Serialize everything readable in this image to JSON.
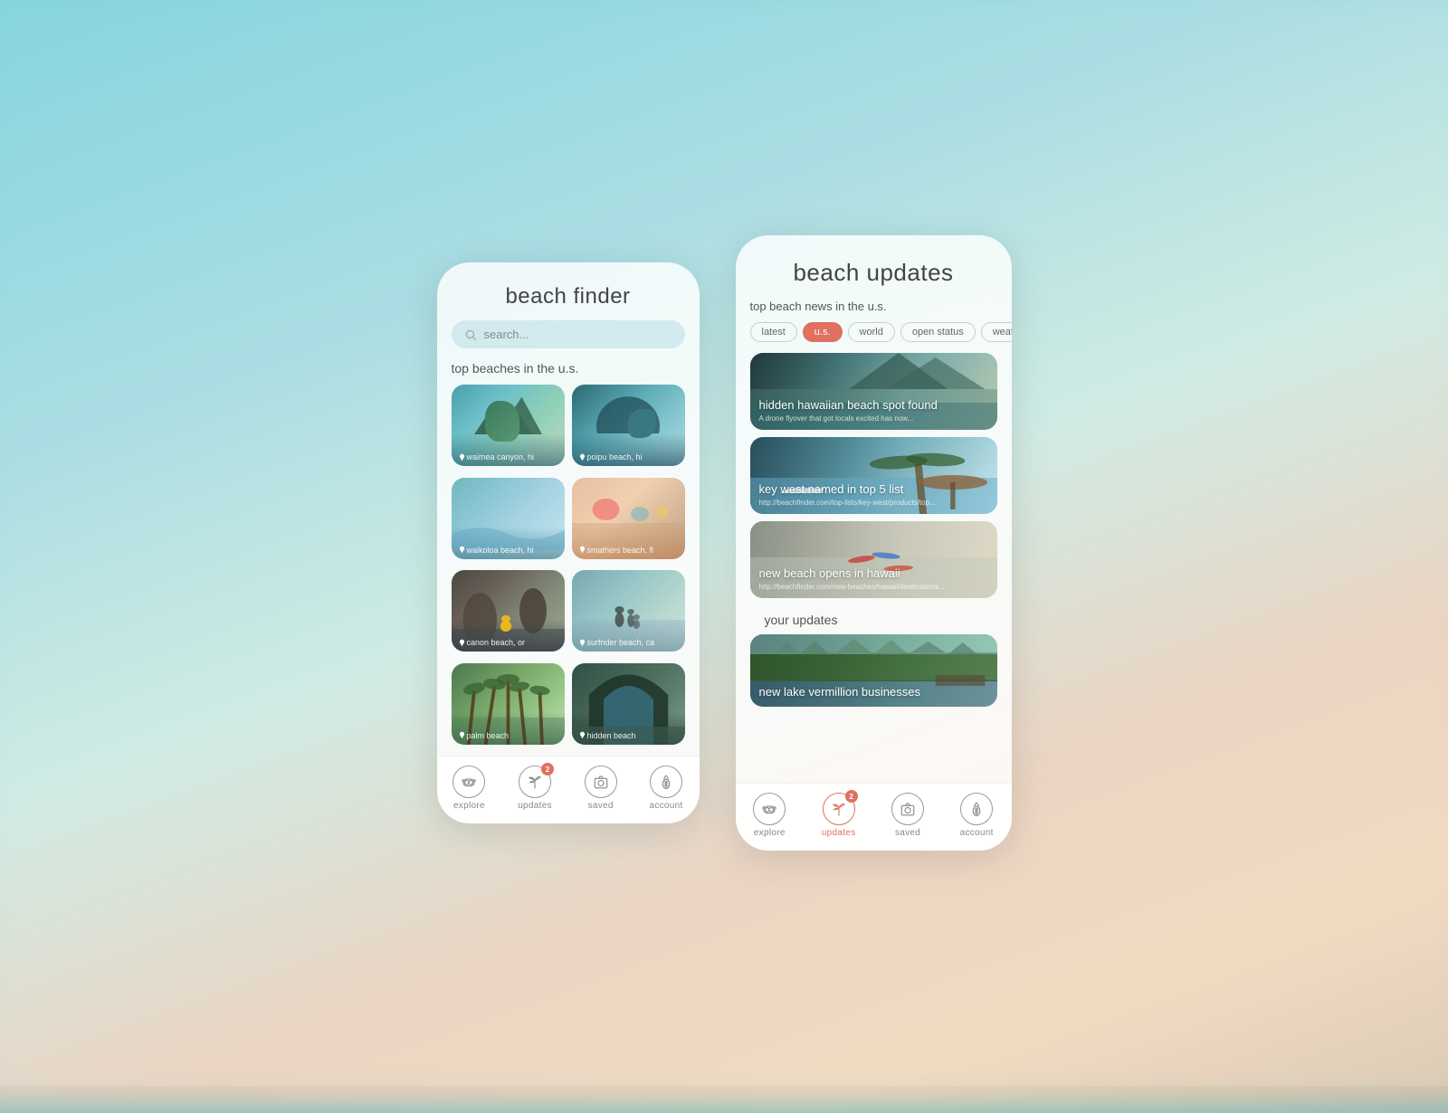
{
  "background": {
    "colors": [
      "#6ecdd8",
      "#9dd8de",
      "#c8e8e0",
      "#e8cdb8",
      "#f0d5b8"
    ]
  },
  "left_phone": {
    "title": "beach finder",
    "search_placeholder": "search...",
    "section_top_beaches": "top beaches in the u.s.",
    "beaches": [
      {
        "label": "waimea canyon, hi",
        "thumb_class": "thumb-1"
      },
      {
        "label": "poipu beach, hi",
        "thumb_class": "thumb-2"
      },
      {
        "label": "waikoloa beach, hi",
        "thumb_class": "thumb-3"
      },
      {
        "label": "smathers beach, fl",
        "thumb_class": "thumb-4"
      },
      {
        "label": "canon beach, or",
        "thumb_class": "thumb-5"
      },
      {
        "label": "surfrider beach, ca",
        "thumb_class": "thumb-6"
      },
      {
        "label": "palm beach",
        "thumb_class": "thumb-7"
      },
      {
        "label": "hidden beach",
        "thumb_class": "thumb-8"
      }
    ],
    "nav": [
      {
        "id": "explore",
        "label": "explore",
        "icon": "dive-mask",
        "active": false,
        "badge": null
      },
      {
        "id": "updates",
        "label": "updates",
        "icon": "palm-tree",
        "active": false,
        "badge": "2"
      },
      {
        "id": "saved",
        "label": "saved",
        "icon": "camera",
        "active": false,
        "badge": null
      },
      {
        "id": "account",
        "label": "account",
        "icon": "pineapple",
        "active": false,
        "badge": null
      }
    ]
  },
  "right_phone": {
    "title": "beach updates",
    "section_top_news": "top beach news in the u.s.",
    "filter_chips": [
      {
        "label": "latest",
        "active": false
      },
      {
        "label": "u.s.",
        "active": true
      },
      {
        "label": "world",
        "active": false
      },
      {
        "label": "open status",
        "active": false
      },
      {
        "label": "weather",
        "active": false
      }
    ],
    "news_articles": [
      {
        "headline": "hidden hawaiian beach spot found",
        "sub": "A drone flyover that got locals excited has now...",
        "bg_class": "news-bg-1"
      },
      {
        "headline": "key west named in top 5 list",
        "sub": "http://beachfinder.com/top-lists/key-west/products/top...",
        "bg_class": "news-bg-2"
      },
      {
        "headline": "new beach opens in hawaii",
        "sub": "http://beachfinder.com/new-beaches/hawaii/destinations...",
        "bg_class": "news-bg-3"
      }
    ],
    "section_your_updates": "your updates",
    "your_updates": [
      {
        "headline": "new lake vermillion businesses",
        "bg_class": "news-bg-4"
      }
    ],
    "nav": [
      {
        "id": "explore",
        "label": "explore",
        "icon": "dive-mask",
        "active": false,
        "badge": null
      },
      {
        "id": "updates",
        "label": "updates",
        "icon": "palm-tree",
        "active": true,
        "badge": "2"
      },
      {
        "id": "saved",
        "label": "saved",
        "icon": "camera",
        "active": false,
        "badge": null
      },
      {
        "id": "account",
        "label": "account",
        "icon": "pineapple",
        "active": false,
        "badge": null
      }
    ]
  }
}
